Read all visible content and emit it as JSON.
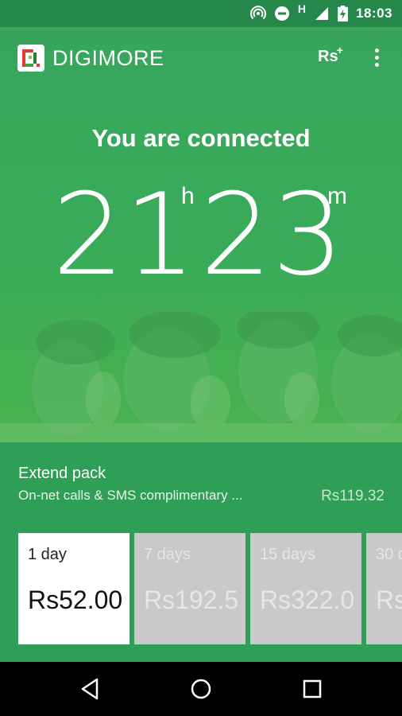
{
  "status_bar": {
    "time": "18:03",
    "icons": [
      "hotspot-icon",
      "do-not-disturb-icon",
      "h-network-icon",
      "signal-icon",
      "battery-charging-icon"
    ],
    "network_label": "H"
  },
  "app_bar": {
    "brand": "DIGIMORE",
    "logo_icon": "digimore-logo-icon",
    "topup_label": "Rs",
    "topup_plus": "+",
    "menu_icon": "more-vert-icon"
  },
  "connection": {
    "status_text": "You are connected",
    "hours": "21",
    "hours_unit": "h",
    "minutes": "23",
    "minutes_unit": "m"
  },
  "extend_pack": {
    "title": "Extend pack",
    "description": "On-net calls & SMS complimentary ...",
    "price": "Rs119.32",
    "options": [
      {
        "days": "1 day",
        "price": "Rs52.00",
        "selected": true
      },
      {
        "days": "7 days",
        "price": "Rs192.5",
        "selected": false
      },
      {
        "days": "15 days",
        "price": "Rs322.0",
        "selected": false
      },
      {
        "days": "30 d",
        "price": "Rs",
        "selected": false
      }
    ]
  },
  "colors": {
    "primary_green": "#2f9e57",
    "status_green": "#25874a",
    "card_inactive": "#c9c9c9",
    "card_active": "#ffffff"
  },
  "nav_bar": {
    "icons": [
      "back-icon",
      "home-icon",
      "recents-icon"
    ]
  }
}
